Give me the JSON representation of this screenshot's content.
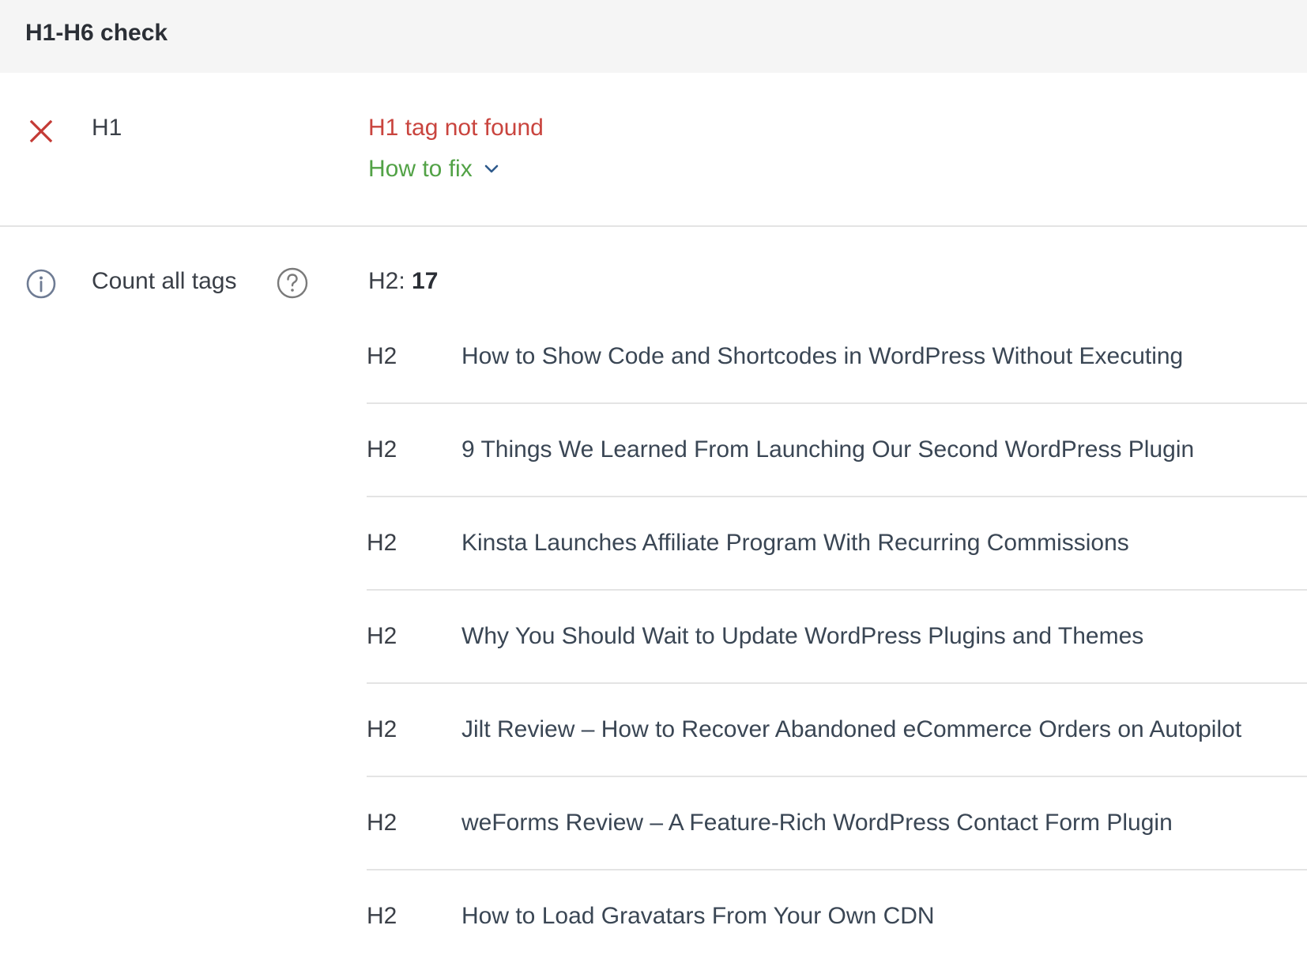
{
  "header": {
    "title": "H1-H6 check"
  },
  "h1_check": {
    "label": "H1",
    "status_icon": "x-icon",
    "status_text": "H1 tag not found",
    "how_to_fix_label": "How to fix",
    "colors": {
      "error": "#c9443e",
      "fix_link": "#52a246"
    }
  },
  "count_tags": {
    "label": "Count all tags",
    "info_icon": "info-icon",
    "help_icon": "question-icon",
    "summary_tag": "H2:",
    "summary_count": "17",
    "rows": [
      {
        "tag": "H2",
        "text": "How to Show Code and Shortcodes in WordPress Without Executing"
      },
      {
        "tag": "H2",
        "text": "9 Things We Learned From Launching Our Second WordPress Plugin"
      },
      {
        "tag": "H2",
        "text": "Kinsta Launches Affiliate Program With Recurring Commissions"
      },
      {
        "tag": "H2",
        "text": "Why You Should Wait to Update WordPress Plugins and Themes"
      },
      {
        "tag": "H2",
        "text": "Jilt Review – How to Recover Abandoned eCommerce Orders on Autopilot"
      },
      {
        "tag": "H2",
        "text": "weForms Review – A Feature-Rich WordPress Contact Form Plugin"
      },
      {
        "tag": "H2",
        "text": "How to Load Gravatars From Your Own CDN"
      }
    ]
  }
}
